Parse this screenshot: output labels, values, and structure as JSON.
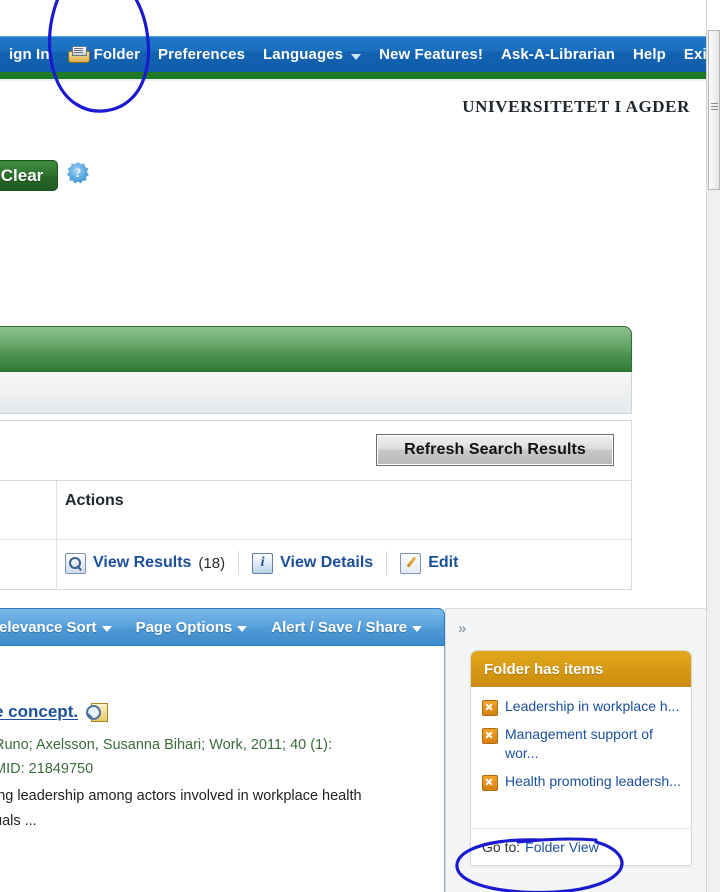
{
  "topnav": {
    "items": [
      {
        "label": "ign In",
        "icon": null,
        "caret": false
      },
      {
        "label": "Folder",
        "icon": "printer-folder-icon",
        "caret": false
      },
      {
        "label": "Preferences",
        "icon": null,
        "caret": false
      },
      {
        "label": "Languages",
        "icon": null,
        "caret": true
      },
      {
        "label": "New Features!",
        "icon": null,
        "caret": false
      },
      {
        "label": "Ask-A-Librarian",
        "icon": null,
        "caret": false
      },
      {
        "label": "Help",
        "icon": null,
        "caret": false
      },
      {
        "label": "Exit",
        "icon": null,
        "caret": false
      }
    ]
  },
  "brand": {
    "title": "UNIVERSITETET I AGDER"
  },
  "search_controls": {
    "clear_label": "Clear",
    "help_glyph": "?"
  },
  "refresh": {
    "button_label": "Refresh Search Results"
  },
  "actions_table": {
    "header": "Actions",
    "actions": [
      {
        "icon": "magnifier-icon",
        "label": "View Results",
        "count": "(18)"
      },
      {
        "icon": "info-icon",
        "label": "View Details",
        "count": ""
      },
      {
        "icon": "edit-pencil-icon",
        "label": "Edit",
        "count": ""
      }
    ]
  },
  "result_toolbar": {
    "items": [
      {
        "label": "elevance Sort",
        "caret": true
      },
      {
        "label": "Page Options",
        "caret": true
      },
      {
        "label": "Alert / Save / Share",
        "caret": true
      }
    ]
  },
  "result_item": {
    "title": "e concept.",
    "preview_icon": "preview-magnifier-icon",
    "meta_line1": "Runo; Axelsson, Susanna Bihari; Work, 2011; 40 (1):",
    "meta_line2": "MID: 21849750",
    "snippet_line1": "ing leadership among actors involved in workplace health",
    "snippet_line2": "uals ..."
  },
  "folder_panel": {
    "collapse_glyph": "»",
    "title": "Folder has items",
    "items": [
      {
        "remove_icon": "remove-x-icon",
        "label": "Leadership in workplace h..."
      },
      {
        "remove_icon": "remove-x-icon",
        "label": "Management support of wor..."
      },
      {
        "remove_icon": "remove-x-icon",
        "label": "Health promoting leadersh..."
      }
    ],
    "footer_prefix": "Go to:",
    "footer_link": "Folder View"
  },
  "colors": {
    "nav_blue": "#1464b4",
    "green_rule": "#1e7a27",
    "panel_green": "#2f7a36",
    "toolbar_blue": "#4e99d6",
    "folder_orange": "#d79a16",
    "link_blue": "#1b4f9c",
    "meta_green": "#3c6b3c",
    "annotation_ink": "#1a1ad0"
  }
}
